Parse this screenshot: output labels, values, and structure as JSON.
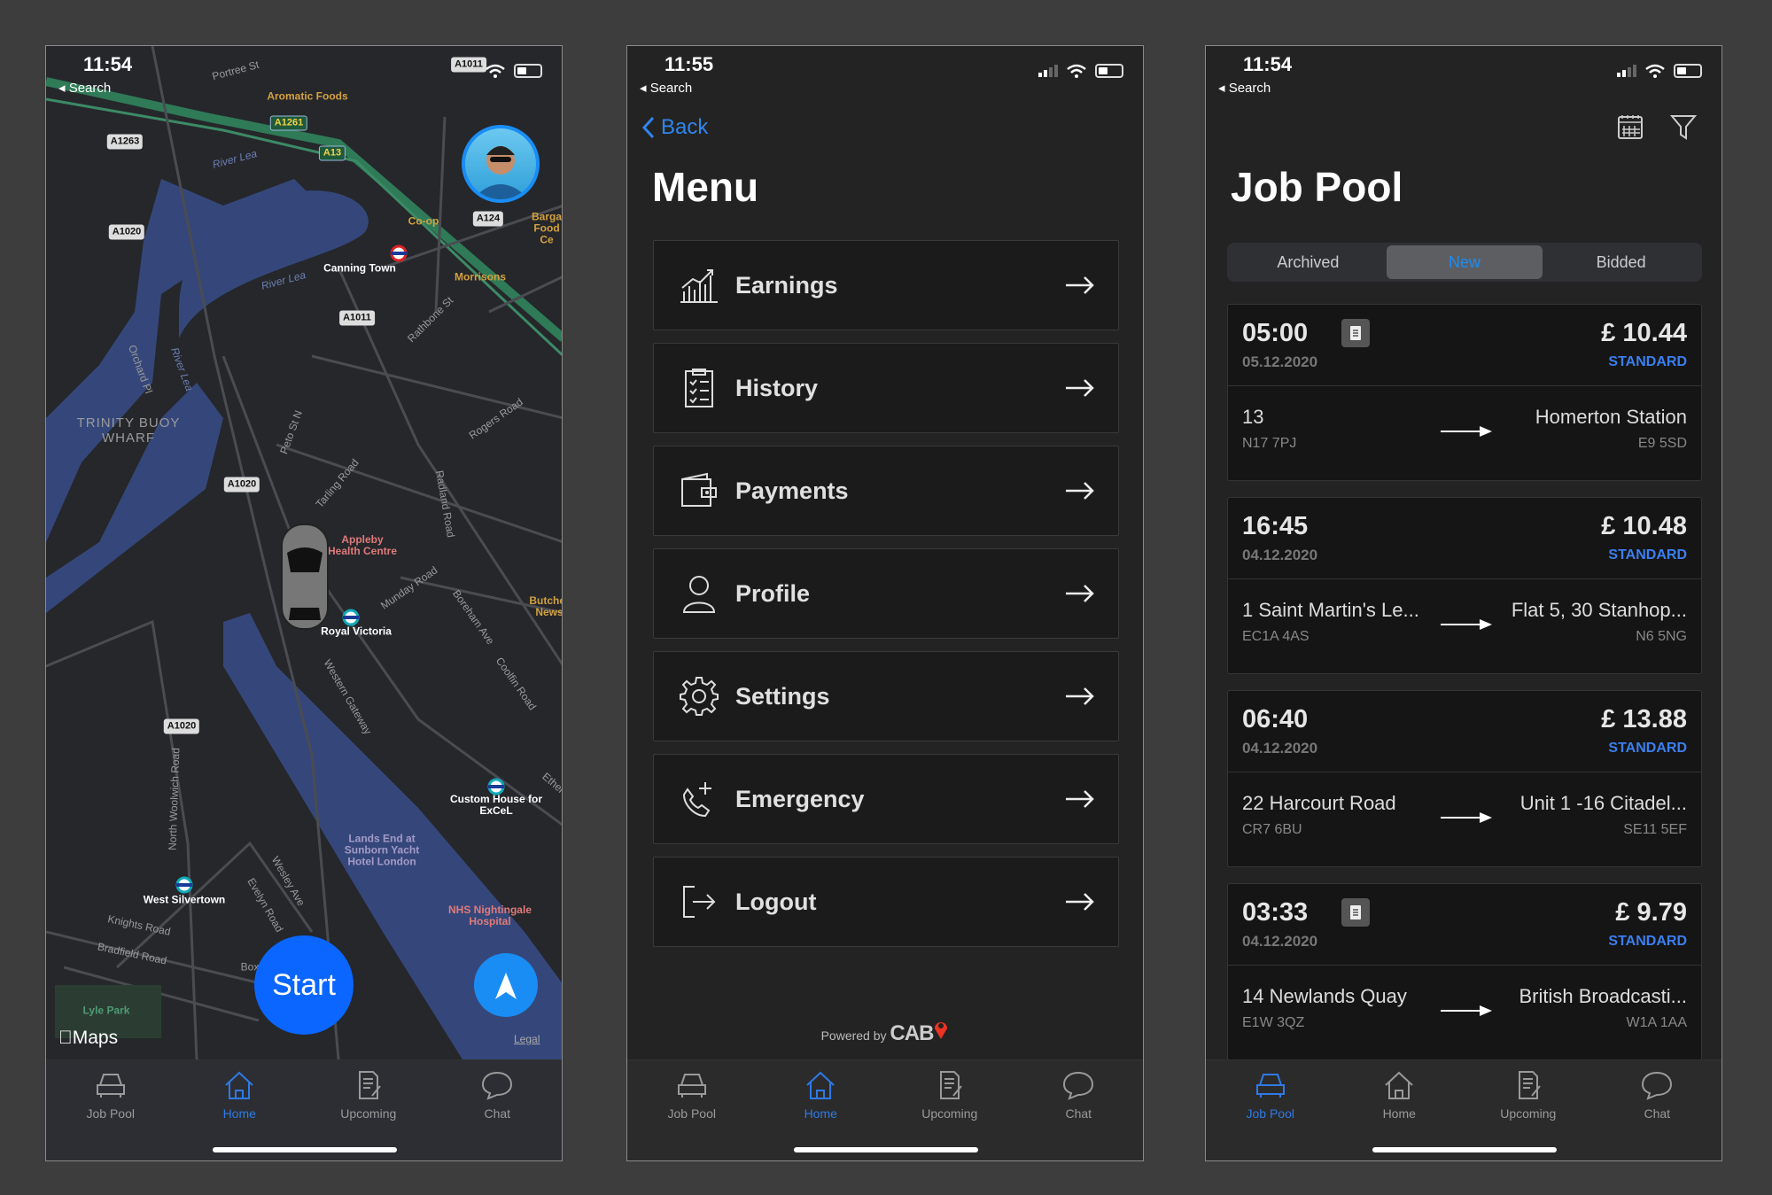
{
  "colors": {
    "accent": "#2f7ae5",
    "start_button": "#0a66ff",
    "standard": "#3b7ff0",
    "background": "#232323"
  },
  "tabs": [
    {
      "label": "Job Pool",
      "icon": "car-icon"
    },
    {
      "label": "Home",
      "icon": "home-icon"
    },
    {
      "label": "Upcoming",
      "icon": "document-edit-icon"
    },
    {
      "label": "Chat",
      "icon": "chat-bubble-icon"
    }
  ],
  "map_screen": {
    "status": {
      "time": "11:54",
      "back": "Search"
    },
    "start_label": "Start",
    "maps_label": "Maps",
    "legal_label": "Legal",
    "active_tab": "Home",
    "labels": {
      "portree": "Portree St",
      "aromatic": "Aromatic Foods",
      "a1261": "A1261",
      "a1263": "A1263",
      "riverlea1": "River Lea",
      "a13": "A13",
      "a1020a": "A1020",
      "coop": "Co-op",
      "a124": "A124",
      "barga": "Barga Food Ce",
      "canning": "Canning Town",
      "morrisons": "Morrisons",
      "riverlea2": "River Lea",
      "a1011a": "A1011",
      "a1011top": "A1011",
      "rathbone": "Rathbone St",
      "orchard": "Orchard Pl",
      "riverlea3": "River Lea",
      "trinity": "TRINITY BUOY WHARF",
      "rogers": "Rogers Road",
      "peto": "Peto St N",
      "tarling": "Tarling Road",
      "radland": "Radland Road",
      "a1020b": "A1020",
      "appleby": "Appleby Health Centre",
      "munday": "Munday Road",
      "boreham": "Boreham Ave",
      "butcher": "Butcher News",
      "royal": "Royal Victoria",
      "western": "Western Gateway",
      "coolfin": "Coolfin Road",
      "a1020c": "A1020",
      "northwoolwich": "North Woolwich Road",
      "custom": "Custom House for ExCeL",
      "ethel": "Ethel",
      "landsend": "Lands End at Sunborn Yacht Hotel London",
      "wesley": "Wesley Ave",
      "evelyn": "Evelyn Road",
      "westsilvertown": "West Silvertown",
      "knights": "Knights Road",
      "bradfield": "Bradfield Road",
      "nhs": "NHS Nightingale Hospital",
      "lyle": "Lyle Park",
      "box": "Box"
    }
  },
  "menu_screen": {
    "status": {
      "time": "11:55",
      "back": "Search"
    },
    "back_label": "Back",
    "title": "Menu",
    "active_tab": "Home",
    "items": [
      {
        "label": "Earnings",
        "icon": "chart-icon"
      },
      {
        "label": "History",
        "icon": "clipboard-icon"
      },
      {
        "label": "Payments",
        "icon": "wallet-icon"
      },
      {
        "label": "Profile",
        "icon": "person-icon"
      },
      {
        "label": "Settings",
        "icon": "gear-icon"
      },
      {
        "label": "Emergency",
        "icon": "phone-plus-icon"
      },
      {
        "label": "Logout",
        "icon": "logout-icon"
      }
    ],
    "powered_by": "Powered by",
    "brand": "CAB"
  },
  "jobpool_screen": {
    "status": {
      "time": "11:54",
      "back": "Search"
    },
    "title": "Job Pool",
    "active_tab": "Job Pool",
    "segments": [
      {
        "label": "Archived"
      },
      {
        "label": "New",
        "selected": true
      },
      {
        "label": "Bidded"
      }
    ],
    "jobs": [
      {
        "time": "05:00",
        "date": "05.12.2020",
        "note": true,
        "price": "£ 10.44",
        "type": "STANDARD",
        "from": "13",
        "from_pc": "N17 7PJ",
        "to": "Homerton Station",
        "to_pc": "E9 5SD"
      },
      {
        "time": "16:45",
        "date": "04.12.2020",
        "note": false,
        "price": "£ 10.48",
        "type": "STANDARD",
        "from": "1 Saint Martin's Le...",
        "from_pc": "EC1A 4AS",
        "to": "Flat 5, 30 Stanhop...",
        "to_pc": "N6 5NG"
      },
      {
        "time": "06:40",
        "date": "04.12.2020",
        "note": false,
        "price": "£ 13.88",
        "type": "STANDARD",
        "from": "22 Harcourt Road",
        "from_pc": "CR7 6BU",
        "to": "Unit 1 -16 Citadel...",
        "to_pc": "SE11 5EF"
      },
      {
        "time": "03:33",
        "date": "04.12.2020",
        "note": true,
        "price": "£ 9.79",
        "type": "STANDARD",
        "from": "14 Newlands Quay",
        "from_pc": "E1W 3QZ",
        "to": "British Broadcasti...",
        "to_pc": "W1A 1AA"
      }
    ]
  }
}
